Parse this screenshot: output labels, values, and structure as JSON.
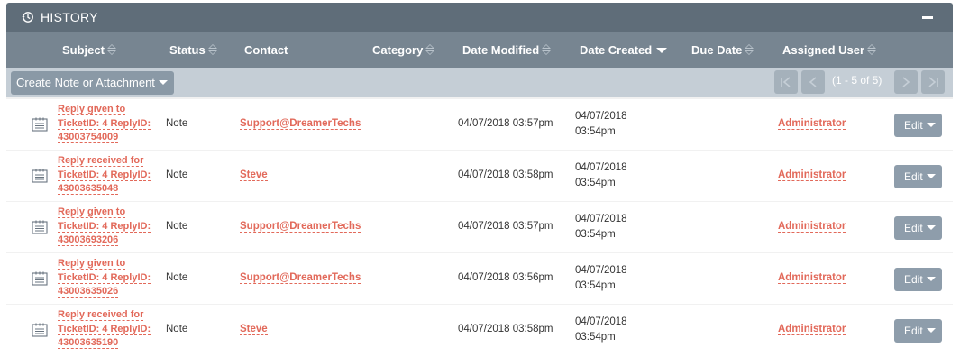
{
  "panel": {
    "title": "HISTORY",
    "icon": "history-icon",
    "collapse_icon": "minus-icon"
  },
  "columns": {
    "subject": "Subject",
    "status": "Status",
    "contact": "Contact",
    "category": "Category",
    "date_modified": "Date Modified",
    "date_created": "Date Created",
    "due_date": "Due Date",
    "assigned_user": "Assigned User"
  },
  "toolbar": {
    "create_label": "Create Note or Attachment",
    "pagination": "(1 - 5 of 5)"
  },
  "rows": [
    {
      "subject": "Reply given to TicketID: 4 ReplyID: 43003754009",
      "status": "Note",
      "contact": "Support@DreamerTechs",
      "date_modified": "04/07/2018 03:57pm",
      "date_created": "04/07/2018 03:54pm",
      "assigned_user": "Administrator",
      "edit_label": "Edit"
    },
    {
      "subject": "Reply received for TicketID: 4 ReplyID: 43003635048",
      "status": "Note",
      "contact": "Steve",
      "date_modified": "04/07/2018 03:58pm",
      "date_created": "04/07/2018 03:54pm",
      "assigned_user": "Administrator",
      "edit_label": "Edit"
    },
    {
      "subject": "Reply given to TicketID: 4 ReplyID: 43003693206",
      "status": "Note",
      "contact": "Support@DreamerTechs",
      "date_modified": "04/07/2018 03:57pm",
      "date_created": "04/07/2018 03:54pm",
      "assigned_user": "Administrator",
      "edit_label": "Edit"
    },
    {
      "subject": "Reply given to TicketID: 4 ReplyID: 43003635026",
      "status": "Note",
      "contact": "Support@DreamerTechs",
      "date_modified": "04/07/2018 03:56pm",
      "date_created": "04/07/2018 03:54pm",
      "assigned_user": "Administrator",
      "edit_label": "Edit"
    },
    {
      "subject": "Reply received for TicketID: 4 ReplyID: 43003635190",
      "status": "Note",
      "contact": "Steve",
      "date_modified": "04/07/2018 03:58pm",
      "date_created": "04/07/2018 03:54pm",
      "assigned_user": "Administrator",
      "edit_label": "Edit"
    }
  ],
  "colors": {
    "header": "#5f6d79",
    "column_header": "#778591",
    "toolbar": "#c5ced6",
    "link": "#e2695a",
    "button": "#8e9dab"
  }
}
